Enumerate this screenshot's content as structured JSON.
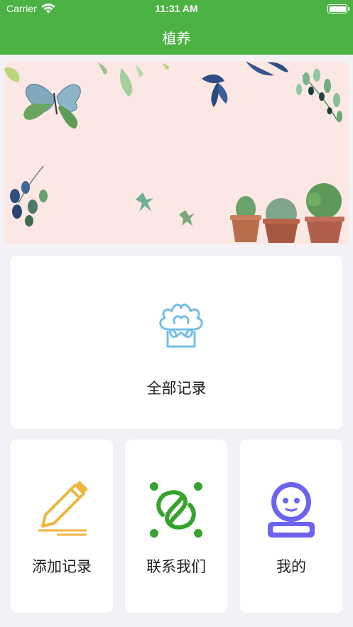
{
  "status_bar": {
    "carrier": "Carrier",
    "time": "11:31 AM"
  },
  "nav": {
    "title": "植养"
  },
  "banner": {
    "description_icon": "botanical-banner-image"
  },
  "menu": {
    "all_records": {
      "label": "全部记录",
      "icon": "plant-pot-icon",
      "color": "#74bfea"
    },
    "add_record": {
      "label": "添加记录",
      "icon": "pencil-icon",
      "color": "#eeb53f"
    },
    "contact_us": {
      "label": "联系我们",
      "icon": "link-icon",
      "color": "#35a32c"
    },
    "mine": {
      "label": "我的",
      "icon": "user-icon",
      "color": "#6c63ee"
    }
  },
  "colors": {
    "nav_background": "#4db244",
    "page_background": "#f2f2f6",
    "card_background": "#ffffff"
  }
}
